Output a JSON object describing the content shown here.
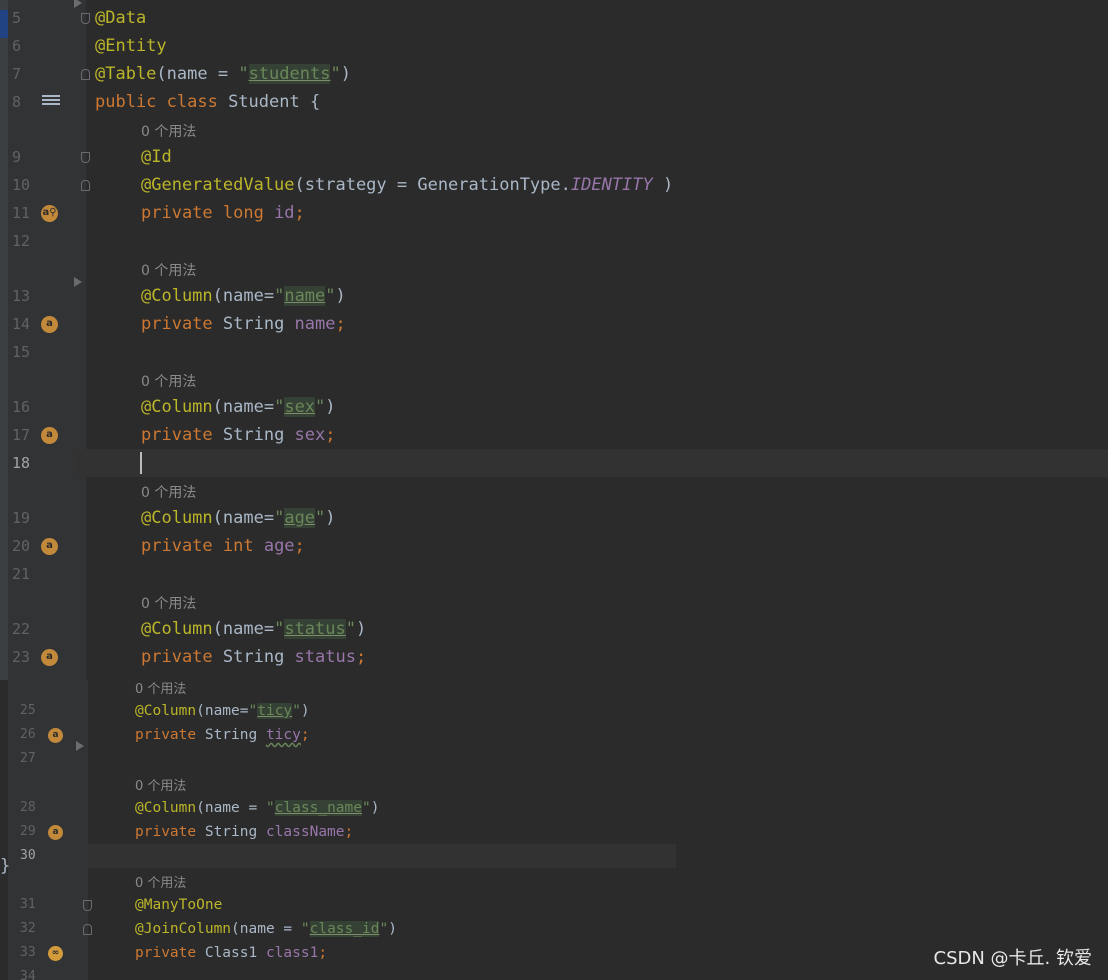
{
  "editor": {
    "usage_hint": "0 个用法",
    "left_brace": "}",
    "lines_top": [
      {
        "n": "5",
        "tokens": [
          {
            "t": "@Data",
            "c": "ann"
          }
        ]
      },
      {
        "n": "6",
        "tokens": [
          {
            "t": "@Entity",
            "c": "ann"
          }
        ]
      },
      {
        "n": "7",
        "tokens": [
          {
            "t": "@Table",
            "c": "ann"
          },
          {
            "t": "(name = ",
            "c": "plain"
          },
          {
            "t": "\"",
            "c": "str"
          },
          {
            "t": "students",
            "c": "strhl"
          },
          {
            "t": "\"",
            "c": "str"
          },
          {
            "t": ")",
            "c": "plain"
          }
        ]
      },
      {
        "n": "8",
        "tokens": [
          {
            "t": "public class ",
            "c": "kw"
          },
          {
            "t": "Student {",
            "c": "plain"
          }
        ]
      },
      {
        "n": "9",
        "tokens": [
          {
            "t": "@Id",
            "c": "ann"
          }
        ]
      },
      {
        "n": "10",
        "tokens": [
          {
            "t": "@GeneratedValue",
            "c": "ann"
          },
          {
            "t": "(strategy = GenerationType.",
            "c": "plain"
          },
          {
            "t": "IDENTITY",
            "c": "italic-const"
          },
          {
            "t": " )",
            "c": "plain"
          }
        ]
      },
      {
        "n": "11",
        "tokens": [
          {
            "t": "private long ",
            "c": "kw"
          },
          {
            "t": "id",
            "c": "field"
          },
          {
            "t": ";",
            "c": "kw"
          }
        ]
      },
      {
        "n": "12",
        "tokens": []
      },
      {
        "n": "13",
        "tokens": [
          {
            "t": "@Column",
            "c": "ann"
          },
          {
            "t": "(name=",
            "c": "plain"
          },
          {
            "t": "\"",
            "c": "str"
          },
          {
            "t": "name",
            "c": "strhl"
          },
          {
            "t": "\"",
            "c": "str"
          },
          {
            "t": ")",
            "c": "plain"
          }
        ]
      },
      {
        "n": "14",
        "tokens": [
          {
            "t": "private ",
            "c": "kw"
          },
          {
            "t": "String ",
            "c": "plain"
          },
          {
            "t": "name",
            "c": "field"
          },
          {
            "t": ";",
            "c": "kw"
          }
        ]
      },
      {
        "n": "15",
        "tokens": []
      },
      {
        "n": "16",
        "tokens": [
          {
            "t": "@Column",
            "c": "ann"
          },
          {
            "t": "(name=",
            "c": "plain"
          },
          {
            "t": "\"",
            "c": "str"
          },
          {
            "t": "sex",
            "c": "strhl"
          },
          {
            "t": "\"",
            "c": "str"
          },
          {
            "t": ")",
            "c": "plain"
          }
        ]
      },
      {
        "n": "17",
        "tokens": [
          {
            "t": "private ",
            "c": "kw"
          },
          {
            "t": "String ",
            "c": "plain"
          },
          {
            "t": "sex",
            "c": "field"
          },
          {
            "t": ";",
            "c": "kw"
          }
        ]
      },
      {
        "n": "18",
        "tokens": []
      },
      {
        "n": "19",
        "tokens": [
          {
            "t": "@Column",
            "c": "ann"
          },
          {
            "t": "(name=",
            "c": "plain"
          },
          {
            "t": "\"",
            "c": "str"
          },
          {
            "t": "age",
            "c": "strhl"
          },
          {
            "t": "\"",
            "c": "str"
          },
          {
            "t": ")",
            "c": "plain"
          }
        ]
      },
      {
        "n": "20",
        "tokens": [
          {
            "t": "private int ",
            "c": "kw"
          },
          {
            "t": "age",
            "c": "field"
          },
          {
            "t": ";",
            "c": "kw"
          }
        ]
      },
      {
        "n": "21",
        "tokens": []
      },
      {
        "n": "22",
        "tokens": [
          {
            "t": "@Column",
            "c": "ann"
          },
          {
            "t": "(name=",
            "c": "plain"
          },
          {
            "t": "\"",
            "c": "str"
          },
          {
            "t": "status",
            "c": "strhl"
          },
          {
            "t": "\"",
            "c": "str"
          },
          {
            "t": ")",
            "c": "plain"
          }
        ]
      },
      {
        "n": "23",
        "tokens": [
          {
            "t": "private ",
            "c": "kw"
          },
          {
            "t": "String ",
            "c": "plain"
          },
          {
            "t": "status",
            "c": "field"
          },
          {
            "t": ";",
            "c": "kw"
          }
        ]
      }
    ],
    "lines_bottom": [
      {
        "n": "25",
        "tokens": [
          {
            "t": "@Column",
            "c": "ann"
          },
          {
            "t": "(name=",
            "c": "plain"
          },
          {
            "t": "\"",
            "c": "str"
          },
          {
            "t": "ticy",
            "c": "strhl"
          },
          {
            "t": "\"",
            "c": "str"
          },
          {
            "t": ")",
            "c": "plain"
          }
        ]
      },
      {
        "n": "26",
        "tokens": [
          {
            "t": "private ",
            "c": "kw"
          },
          {
            "t": "String ",
            "c": "plain"
          },
          {
            "t": "ticy",
            "c": "field squiggle"
          },
          {
            "t": ";",
            "c": "kw"
          }
        ]
      },
      {
        "n": "27",
        "tokens": []
      },
      {
        "n": "28",
        "tokens": [
          {
            "t": "@Column",
            "c": "ann"
          },
          {
            "t": "(name = ",
            "c": "plain"
          },
          {
            "t": "\"",
            "c": "str"
          },
          {
            "t": "class_name",
            "c": "strhl"
          },
          {
            "t": "\"",
            "c": "str"
          },
          {
            "t": ")",
            "c": "plain"
          }
        ]
      },
      {
        "n": "29",
        "tokens": [
          {
            "t": "private ",
            "c": "kw"
          },
          {
            "t": "String ",
            "c": "plain"
          },
          {
            "t": "className",
            "c": "field"
          },
          {
            "t": ";",
            "c": "kw"
          }
        ]
      },
      {
        "n": "30",
        "tokens": []
      },
      {
        "n": "31",
        "tokens": [
          {
            "t": "@ManyToOne",
            "c": "ann"
          }
        ]
      },
      {
        "n": "32",
        "tokens": [
          {
            "t": "@JoinColumn",
            "c": "ann"
          },
          {
            "t": "(name = ",
            "c": "plain"
          },
          {
            "t": "\"",
            "c": "str"
          },
          {
            "t": "class_id",
            "c": "strhl"
          },
          {
            "t": "\"",
            "c": "str"
          },
          {
            "t": ")",
            "c": "plain"
          }
        ]
      },
      {
        "n": "33",
        "tokens": [
          {
            "t": "private ",
            "c": "kw"
          },
          {
            "t": "Class1 ",
            "c": "plain"
          },
          {
            "t": "class1",
            "c": "field"
          },
          {
            "t": ";",
            "c": "kw"
          }
        ]
      },
      {
        "n": "34",
        "tokens": []
      }
    ]
  },
  "watermark": "CSDN @卡丘. 钦爱",
  "icons": {
    "field": "annotation-field-icon",
    "id_field": "id-field-icon",
    "entity": "database-table-icon",
    "relation": "relation-link-icon"
  }
}
